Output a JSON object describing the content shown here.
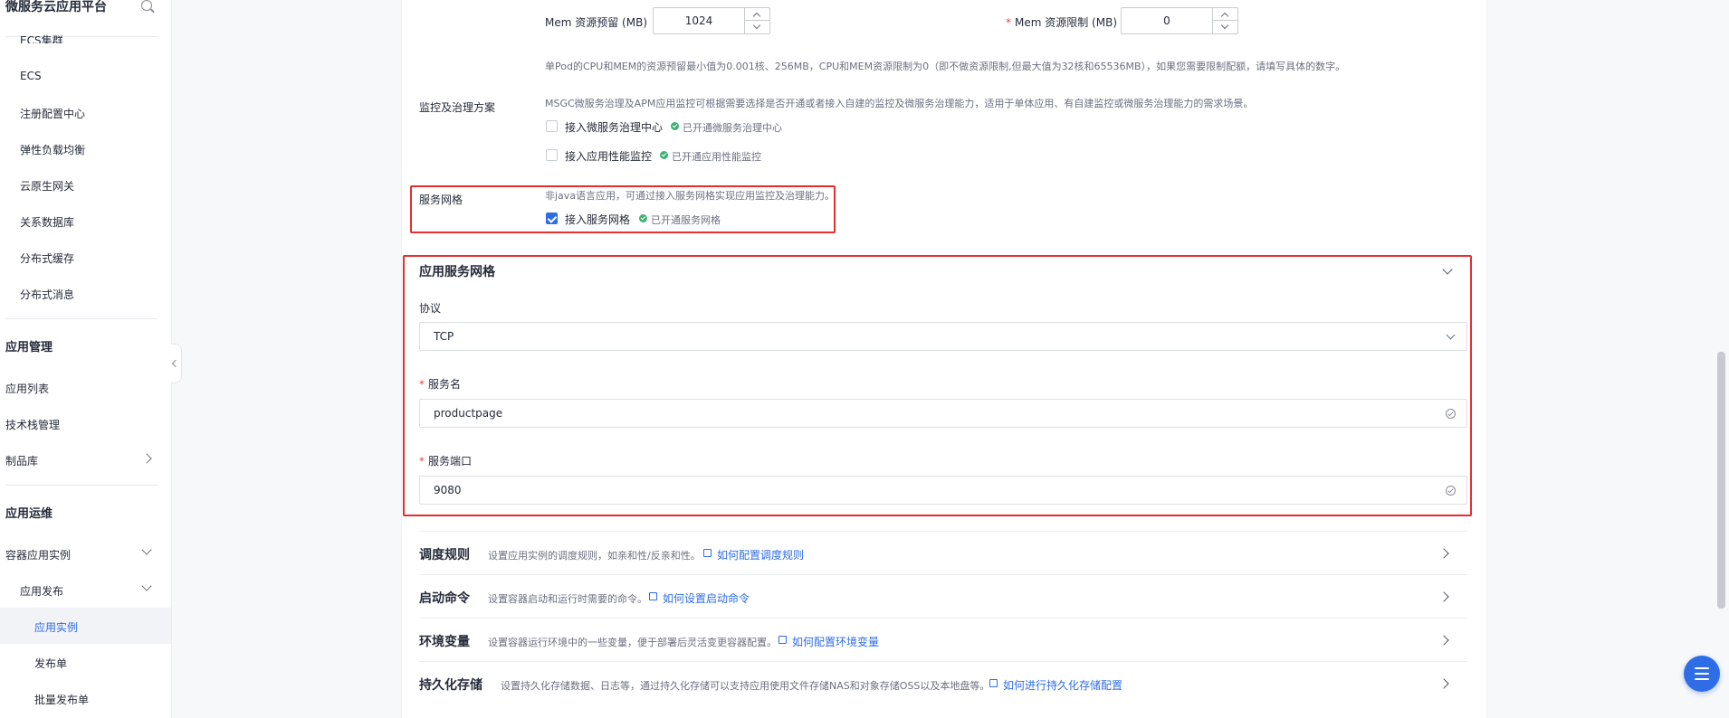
{
  "sidebar": {
    "title": "微服务云应用平台",
    "items": [
      {
        "label": "ECS集群"
      },
      {
        "label": "ECS"
      },
      {
        "label": "注册配置中心"
      },
      {
        "label": "弹性负载均衡"
      },
      {
        "label": "云原生网关"
      },
      {
        "label": "关系数据库"
      },
      {
        "label": "分布式缓存"
      },
      {
        "label": "分布式消息"
      }
    ],
    "group_app_mgmt": "应用管理",
    "app_mgmt_items": [
      {
        "label": "应用列表"
      },
      {
        "label": "技术栈管理"
      },
      {
        "label": "制品库"
      }
    ],
    "group_app_ops": "应用运维",
    "ops_items": [
      {
        "label": "容器应用实例"
      },
      {
        "label": "应用发布"
      },
      {
        "label": "应用实例"
      },
      {
        "label": "发布单"
      },
      {
        "label": "批量发布单"
      }
    ]
  },
  "resources": {
    "mem_reserve_label": "Mem 资源预留 (MB)",
    "mem_reserve_value": "1024",
    "mem_limit_label": "Mem 资源限制 (MB)",
    "mem_limit_value": "0",
    "hint": "单Pod的CPU和MEM的资源预留最小值为0.001核、256MB，CPU和MEM资源限制为0（即不做资源限制,但最大值为32核和65536MB），如果您需要限制配额，请填写具体的数字。"
  },
  "monitoring": {
    "label": "监控及治理方案",
    "desc": "MSGC微服务治理及APM应用监控可根据需要选择是否开通或者接入自建的监控及微服务治理能力，适用于单体应用、有自建监控或微服务治理能力的需求场景。",
    "option1": "接入微服务治理中心",
    "option1_status": "已开通微服务治理中心",
    "option2": "接入应用性能监控",
    "option2_status": "已开通应用性能监控"
  },
  "mesh": {
    "label": "服务网格",
    "desc": "非java语言应用，可通过接入服务网格实现应用监控及治理能力。",
    "option": "接入服务网格",
    "status": "已开通服务网格"
  },
  "app_mesh": {
    "title": "应用服务网格",
    "protocol_label": "协议",
    "protocol_value": "TCP",
    "service_name_label": "服务名",
    "service_name_value": "productpage",
    "service_port_label": "服务端口",
    "service_port_value": "9080"
  },
  "collapsibles": [
    {
      "title": "调度规则",
      "desc": "设置应用实例的调度规则，如亲和性/反亲和性。",
      "link": "如何配置调度规则"
    },
    {
      "title": "启动命令",
      "desc": "设置容器启动和运行时需要的命令。",
      "link": "如何设置启动命令"
    },
    {
      "title": "环境变量",
      "desc": "设置容器运行环境中的一些变量，便于部署后灵活变更容器配置。",
      "link": "如何配置环境变量"
    },
    {
      "title": "持久化存储",
      "desc": "设置持久化存储数据、日志等，通过持久化存储可以支持应用使用文件存储NAS和对象存储OSS以及本地盘等。",
      "link": "如何进行持久化存储配置"
    }
  ],
  "colors": {
    "accent": "#2f6de6",
    "highlight": "#e62e2e",
    "success": "#3cb371"
  }
}
